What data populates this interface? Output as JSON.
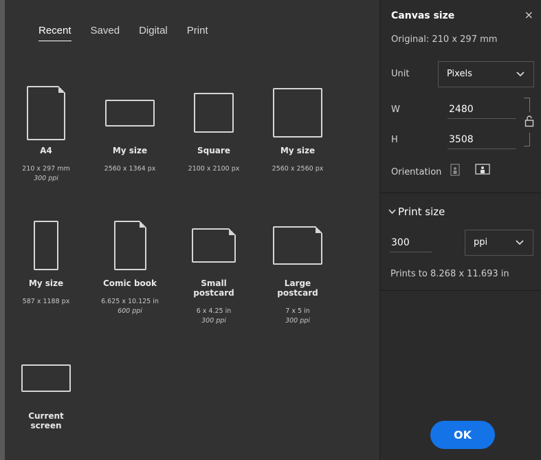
{
  "tabs": [
    "Recent",
    "Saved",
    "Digital",
    "Print"
  ],
  "presets": [
    {
      "name": "A4",
      "dims": "210 x 297 mm",
      "ppi": "300 ppi"
    },
    {
      "name": "My size",
      "dims": "2560 x 1364 px",
      "ppi": ""
    },
    {
      "name": "Square",
      "dims": "2100 x 2100 px",
      "ppi": ""
    },
    {
      "name": "My size",
      "dims": "2560 x 2560 px",
      "ppi": ""
    },
    {
      "name": "My size",
      "dims": "587 x 1188 px",
      "ppi": ""
    },
    {
      "name": "Comic book",
      "dims": "6.625 x 10.125 in",
      "ppi": "600 ppi"
    },
    {
      "name": "Small postcard",
      "dims": "6 x 4.25 in",
      "ppi": "300 ppi"
    },
    {
      "name": "Large postcard",
      "dims": "7 x 5 in",
      "ppi": "300 ppi"
    },
    {
      "name": "Current screen",
      "dims": "",
      "ppi": ""
    }
  ],
  "panel": {
    "title": "Canvas size",
    "close_icon": "×",
    "original": "Original: 210 x 297 mm",
    "unit_label": "Unit",
    "unit_value": "Pixels",
    "w_label": "W",
    "w_value": "2480",
    "h_label": "H",
    "h_value": "3508",
    "orientation_label": "Orientation",
    "print_size_label": "Print size",
    "resolution_value": "300",
    "resolution_unit": "ppi",
    "prints_to": "Prints to 8.268 x 11.693 in",
    "ok_label": "OK"
  },
  "colors": {
    "accent": "#1473e6",
    "background": "#323232",
    "panel": "#2b2b2b"
  }
}
